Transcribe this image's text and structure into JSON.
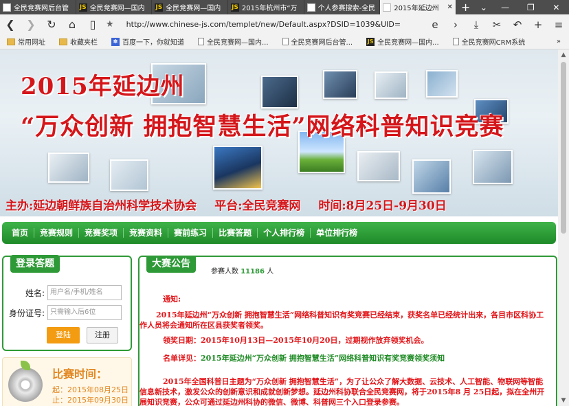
{
  "browser": {
    "tabs": [
      {
        "icon": "page-icon",
        "title": "全民竞赛网后台管",
        "active": false
      },
      {
        "icon": "js-icon",
        "title": "全民竞赛网—国内",
        "active": false
      },
      {
        "icon": "js-icon",
        "title": "全民竞赛网—国内",
        "active": false
      },
      {
        "icon": "js-icon",
        "title": "2015年杭州市“万",
        "active": false
      },
      {
        "icon": "page-icon",
        "title": "个人参赛搜索-全民",
        "active": false
      },
      {
        "icon": "page-icon",
        "title": "2015年延边州",
        "active": true
      }
    ],
    "url": "http://www.chinese-js.com/templet/new/Default.aspx?DSID=1039&UID=",
    "favorites": [
      {
        "icon": "folder-icon",
        "label": "常用网址"
      },
      {
        "icon": "folder-icon",
        "label": "收藏夹栏"
      },
      {
        "icon": "baidu-icon",
        "label": "百度一下，你就知道"
      },
      {
        "icon": "page-icon",
        "label": "全民竞赛网—国内..."
      },
      {
        "icon": "page-icon",
        "label": "全民竞赛网后台管..."
      },
      {
        "icon": "js-icon",
        "label": "全民竞赛网—国内..."
      },
      {
        "icon": "page-icon",
        "label": "全民竞赛网CRM系统"
      }
    ]
  },
  "banner": {
    "year_title": "2015年延边州",
    "slogan": "“万众创新 拥抱智慧生活”网络科普知识竞赛",
    "host": "主办:延边朝鲜族自治州科学技术协会",
    "platform": "平台:全民竞赛网",
    "time": "时间:8月25日-9月30日"
  },
  "menu": [
    "首页",
    "竞赛规则",
    "竞赛奖项",
    "竞赛资料",
    "赛前练习",
    "比赛答题",
    "个人排行榜",
    "单位排行榜"
  ],
  "login": {
    "title": "登录答题",
    "name_label": "姓名:",
    "name_placeholder": "用户名/手机/姓名",
    "id_label": "身份证号:",
    "id_placeholder": "只需输入后6位",
    "login_button": "登陆",
    "register_button": "注册"
  },
  "time_panel": {
    "title": "比赛时间：",
    "start": "起：2015年08月25日",
    "end": "止：2015年09月30日"
  },
  "announcement": {
    "title": "大赛公告",
    "count_label": "参赛人数",
    "count": "11186",
    "count_unit": "人",
    "notice_label": "通知:",
    "p2": "2015年延边州“万众创新 拥抱智慧生活”网络科普知识有奖竞赛已经结束，获奖名单已经统计出来，各目市区科协工作人员将会通知所在区县获奖者领奖。",
    "p3": "领奖日期：2015年10月13日—2015年10月20日，过期视作放弃领奖机会。",
    "p4_label": "名单详见：",
    "p4_link": "2015年延边州“万众创新 拥抱智慧生活”网络科普知识有奖竞赛领奖须知",
    "p5": "2015年全国科普日主题为“万众创新 拥抱智慧生活”，为了让公众了解大数据、云技术、人工智能、物联网等智能信息新技术，激发公众的创新意识和成就创新梦想。延边州科协联合全民竞赛网，将于2015年8 月 25日起，拟在全州开展知识竞赛，公众可通过延边州科协的微信、微博、科普网三个入口登录参赛。"
  }
}
